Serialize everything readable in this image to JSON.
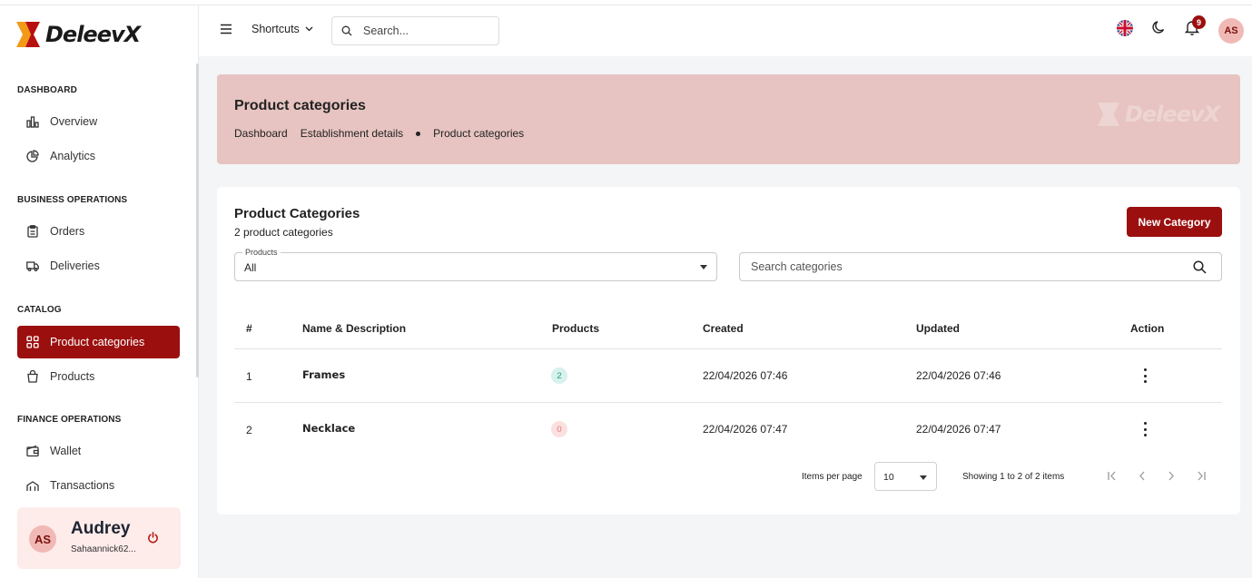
{
  "app": {
    "name": "DeleevX",
    "brand_color": "#9b0f0f"
  },
  "sidebar": {
    "sections": [
      {
        "title": "DASHBOARD",
        "items": [
          {
            "label": "Overview",
            "icon": "bar-chart-icon"
          },
          {
            "label": "Analytics",
            "icon": "pie-chart-icon"
          }
        ]
      },
      {
        "title": "BUSINESS OPERATIONS",
        "items": [
          {
            "label": "Orders",
            "icon": "clipboard-icon"
          },
          {
            "label": "Deliveries",
            "icon": "truck-icon"
          }
        ]
      },
      {
        "title": "CATALOG",
        "items": [
          {
            "label": "Product categories",
            "icon": "grid-icon",
            "active": true
          },
          {
            "label": "Products",
            "icon": "shopping-bag-icon"
          }
        ]
      },
      {
        "title": "FINANCE OPERATIONS",
        "items": [
          {
            "label": "Wallet",
            "icon": "wallet-icon"
          },
          {
            "label": "Transactions",
            "icon": "transactions-icon"
          }
        ]
      }
    ],
    "user": {
      "initials": "AS",
      "name": "Audrey",
      "email": "Sahaannick62..."
    }
  },
  "topbar": {
    "shortcuts_label": "Shortcuts",
    "search_placeholder": "Search...",
    "notification_count": "9",
    "avatar_initials": "AS"
  },
  "banner": {
    "title": "Product categories",
    "breadcrumbs": [
      "Dashboard",
      "Establishment details",
      "Product categories"
    ],
    "watermark": "DeleevX"
  },
  "card": {
    "title": "Product Categories",
    "subtitle": "2 product categories",
    "new_button": "New Category",
    "filter": {
      "label": "Products",
      "value": "All"
    },
    "search_placeholder": "Search categories",
    "columns": [
      "#",
      "Name & Description",
      "Products",
      "Created",
      "Updated",
      "Action"
    ],
    "rows": [
      {
        "num": "1",
        "name": "Frames",
        "products": "2",
        "status": "green",
        "created": "22/04/2026 07:46",
        "updated": "22/04/2026 07:46"
      },
      {
        "num": "2",
        "name": "Necklace",
        "products": "0",
        "status": "red",
        "created": "22/04/2026 07:47",
        "updated": "22/04/2026 07:47"
      }
    ],
    "pagination": {
      "items_per_page_label": "Items per page",
      "items_per_page": "10",
      "showing": "Showing 1 to 2 of 2 items"
    }
  }
}
